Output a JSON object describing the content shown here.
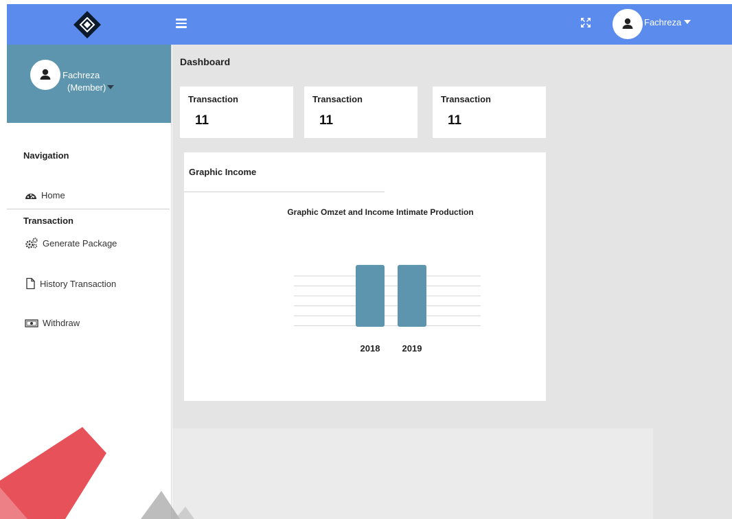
{
  "header": {
    "logo_icon": "diamond-logo",
    "menu_icon": "hamburger-icon",
    "fullscreen_icon": "fullscreen-icon",
    "user_name": "Fachreza",
    "color": "#5b8ced"
  },
  "sidebar": {
    "user_name": "Fachreza",
    "user_role": "(Member)",
    "profile_color": "#5d95ae",
    "navigation_heading": "Navigation",
    "home_label": "Home",
    "transaction_heading": "Transaction",
    "items": [
      {
        "label": "Generate Package",
        "icon": "gears-icon"
      },
      {
        "label": "History Transaction",
        "icon": "file-icon"
      },
      {
        "label": "Withdraw",
        "icon": "money-icon"
      }
    ]
  },
  "main": {
    "title": "Dashboard",
    "cards": [
      {
        "label": "Transaction",
        "value": "11"
      },
      {
        "label": "Transaction",
        "value": "11"
      },
      {
        "label": "Transaction",
        "value": "11"
      }
    ],
    "panel_title": "Graphic Income"
  },
  "chart_data": {
    "type": "bar",
    "title": "Graphic Omzet and Income Intimate Production",
    "categories": [
      "2018",
      "2019"
    ],
    "values": [
      7,
      7
    ],
    "ylim": [
      0,
      8
    ],
    "grid": true,
    "bar_color": "#5d95ae"
  }
}
